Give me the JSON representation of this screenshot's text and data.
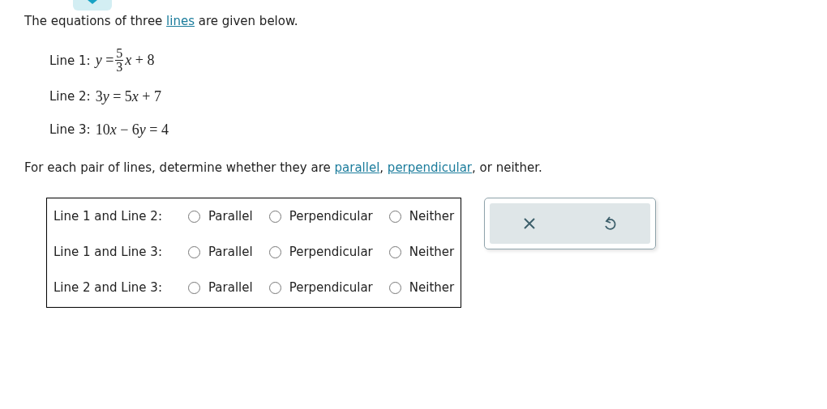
{
  "intro": [
    {
      "kind": "text",
      "text": "The equations of three "
    },
    {
      "kind": "link",
      "text": "lines"
    },
    {
      "kind": "text",
      "text": " are given below."
    }
  ],
  "equations": [
    {
      "label": "Line 1:",
      "parts": [
        {
          "kind": "math",
          "text": "y ="
        },
        {
          "kind": "fraction",
          "numerator": "5",
          "denominator": "3"
        },
        {
          "kind": "math",
          "text": "x + 8"
        }
      ]
    },
    {
      "label": "Line 2:",
      "parts": [
        {
          "kind": "math",
          "text": "3y = 5x + 7"
        }
      ]
    },
    {
      "label": "Line 3:",
      "parts": [
        {
          "kind": "math",
          "text": "10x − 6y = 4"
        }
      ]
    }
  ],
  "question": [
    {
      "kind": "text",
      "text": "For each pair of lines, determine whether they are "
    },
    {
      "kind": "link",
      "text": "parallel"
    },
    {
      "kind": "text",
      "text": ", "
    },
    {
      "kind": "link",
      "text": "perpendicular"
    },
    {
      "kind": "text",
      "text": ", or neither."
    }
  ],
  "pairs": [
    {
      "label": "Line 1 and Line 2:",
      "options": [
        {
          "label": "Parallel",
          "selected": false
        },
        {
          "label": "Perpendicular",
          "selected": false
        },
        {
          "label": "Neither",
          "selected": false
        }
      ]
    },
    {
      "label": "Line 1 and Line 3:",
      "options": [
        {
          "label": "Parallel",
          "selected": false
        },
        {
          "label": "Perpendicular",
          "selected": false
        },
        {
          "label": "Neither",
          "selected": false
        }
      ]
    },
    {
      "label": "Line 2 and Line 3:",
      "options": [
        {
          "label": "Parallel",
          "selected": false
        },
        {
          "label": "Perpendicular",
          "selected": false
        },
        {
          "label": "Neither",
          "selected": false
        }
      ]
    }
  ]
}
